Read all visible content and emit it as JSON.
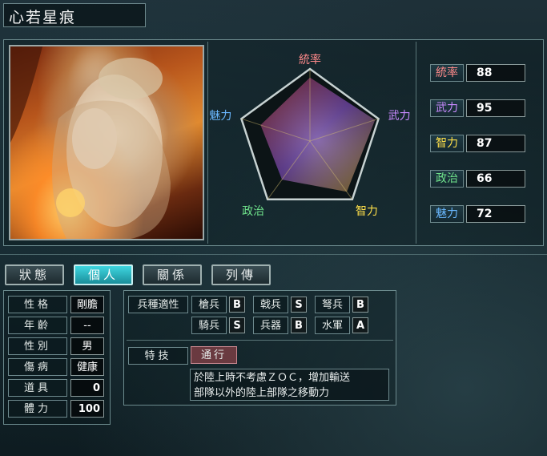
{
  "character": {
    "name": "心若星痕"
  },
  "radar": {
    "labels": [
      "統率",
      "武力",
      "智力",
      "政治",
      "魅力"
    ],
    "label_colors": [
      "#ff8a8a",
      "#c98aff",
      "#ffe04a",
      "#6ee08a",
      "#6ab8ff"
    ]
  },
  "stats": [
    {
      "label": "統率",
      "value": 88,
      "color": "#ff8a8a"
    },
    {
      "label": "武力",
      "value": 95,
      "color": "#c98aff"
    },
    {
      "label": "智力",
      "value": 87,
      "color": "#ffe04a"
    },
    {
      "label": "政治",
      "value": 66,
      "color": "#6ee08a"
    },
    {
      "label": "魅力",
      "value": 72,
      "color": "#6ab8ff"
    }
  ],
  "tabs": [
    "狀態",
    "個人",
    "關係",
    "列傳"
  ],
  "active_tab": "個人",
  "personal": [
    {
      "label": "性格",
      "value": "剛膽"
    },
    {
      "label": "年齡",
      "value": "--"
    },
    {
      "label": "性別",
      "value": "男"
    },
    {
      "label": "傷病",
      "value": "健康"
    },
    {
      "label": "道具",
      "value": "0"
    },
    {
      "label": "體力",
      "value": "100"
    }
  ],
  "troops": {
    "label": "兵種適性",
    "items": [
      {
        "name": "槍兵",
        "grade": "B"
      },
      {
        "name": "戟兵",
        "grade": "S"
      },
      {
        "name": "弩兵",
        "grade": "B"
      },
      {
        "name": "騎兵",
        "grade": "S"
      },
      {
        "name": "兵器",
        "grade": "B"
      },
      {
        "name": "水軍",
        "grade": "A"
      }
    ]
  },
  "skill": {
    "label": "特技",
    "name": "通行",
    "description_line1": "於陸上時不考慮ＺＯＣ，增加輸送",
    "description_line2": "部隊以外的陸上部隊之移動力"
  }
}
